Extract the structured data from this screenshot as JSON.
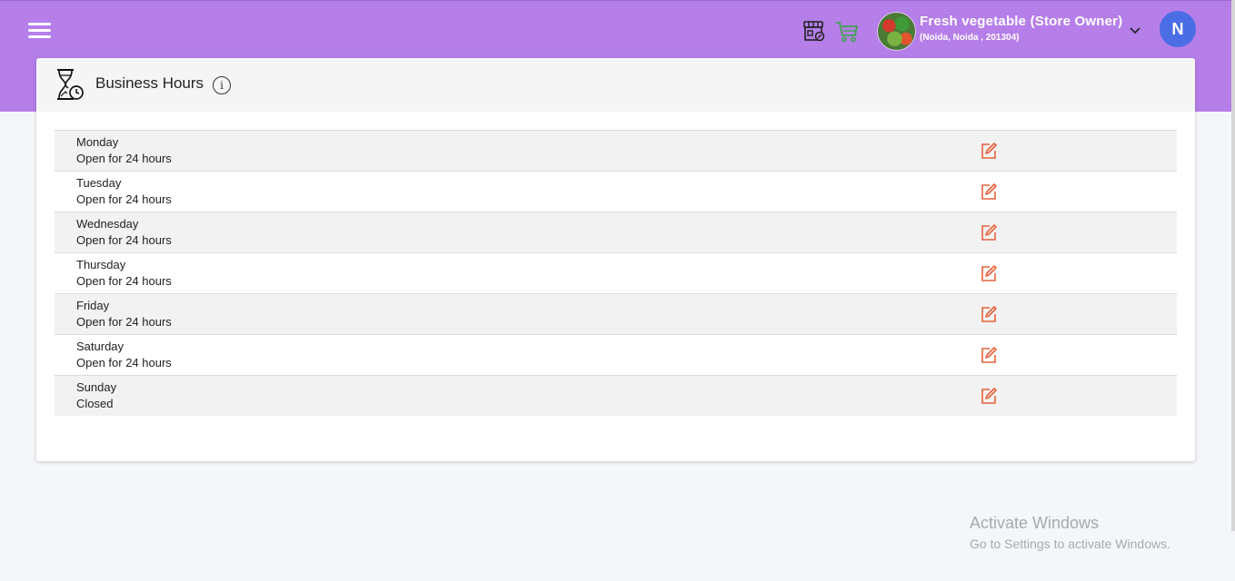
{
  "header": {
    "store_name": "Fresh vegetable (Store Owner)",
    "store_location": "(Noida, Noida , 201304)",
    "user_initial": "N"
  },
  "card": {
    "title": "Business Hours",
    "info_symbol": "i"
  },
  "hours": [
    {
      "day": "Monday",
      "status": "Open for 24 hours"
    },
    {
      "day": "Tuesday",
      "status": "Open for 24 hours"
    },
    {
      "day": "Wednesday",
      "status": "Open for 24 hours"
    },
    {
      "day": "Thursday",
      "status": "Open for 24 hours"
    },
    {
      "day": "Friday",
      "status": "Open for 24 hours"
    },
    {
      "day": "Saturday",
      "status": "Open for 24 hours"
    },
    {
      "day": "Sunday",
      "status": "Closed"
    }
  ],
  "watermark": {
    "title": "Activate Windows",
    "subtitle": "Go to Settings to activate Windows."
  },
  "colors": {
    "topbar": "#b57ee8",
    "accent_edit": "#e8613a",
    "cart": "#3fa34d",
    "avatar": "#4a6de5"
  },
  "icons": [
    "menu-icon",
    "store-icon",
    "cart-icon",
    "chevron-down-icon",
    "hourglass-icon",
    "info-icon",
    "edit-icon"
  ]
}
